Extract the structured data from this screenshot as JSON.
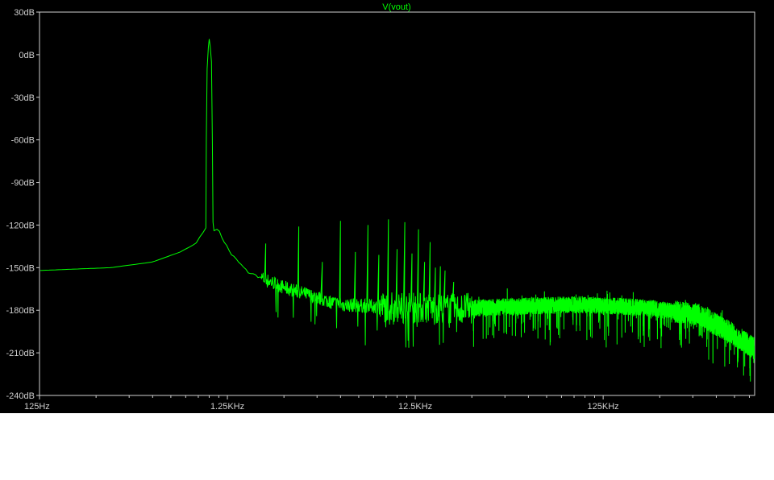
{
  "chart_data": {
    "type": "line",
    "title": "V(vout)",
    "title_color": "#00ff00",
    "background": "#000000",
    "axis_color": "#cfcfcf",
    "trace_color": "#00ff00",
    "x_scale": "log",
    "xlim": [
      125,
      800000
    ],
    "ylim": [
      -240,
      30
    ],
    "grid": false,
    "x_ticks": [
      {
        "value": 125,
        "label": "125Hz"
      },
      {
        "value": 1250,
        "label": "1.25KHz"
      },
      {
        "value": 12500,
        "label": "12.5KHz"
      },
      {
        "value": 125000,
        "label": "125KHz"
      }
    ],
    "y_ticks": [
      {
        "value": 30,
        "label": "30dB"
      },
      {
        "value": 0,
        "label": "0dB"
      },
      {
        "value": -30,
        "label": "-30dB"
      },
      {
        "value": -60,
        "label": "-60dB"
      },
      {
        "value": -90,
        "label": "-90dB"
      },
      {
        "value": -120,
        "label": "-120dB"
      },
      {
        "value": -150,
        "label": "-150dB"
      },
      {
        "value": -180,
        "label": "-180dB"
      },
      {
        "value": -210,
        "label": "-210dB"
      },
      {
        "value": -240,
        "label": "-240dB"
      }
    ],
    "series": [
      {
        "fundamental": {
          "x": 1000,
          "y": 11
        },
        "harmonics": [
          {
            "x": 2000,
            "y": -133
          },
          {
            "x": 3000,
            "y": -121
          },
          {
            "x": 4000,
            "y": -146
          },
          {
            "x": 5000,
            "y": -117
          },
          {
            "x": 6000,
            "y": -139
          },
          {
            "x": 7000,
            "y": -120
          },
          {
            "x": 8000,
            "y": -141
          },
          {
            "x": 9000,
            "y": -116
          },
          {
            "x": 10000,
            "y": -137
          },
          {
            "x": 11000,
            "y": -118
          },
          {
            "x": 12000,
            "y": -140
          },
          {
            "x": 13000,
            "y": -123
          },
          {
            "x": 14000,
            "y": -146
          },
          {
            "x": 15000,
            "y": -132
          },
          {
            "x": 16000,
            "y": -150
          },
          {
            "x": 17000,
            "y": -149
          },
          {
            "x": 18000,
            "y": -152
          },
          {
            "x": 20000,
            "y": -160
          }
        ],
        "floor": [
          {
            "x": 125,
            "y": -152
          },
          {
            "x": 300,
            "y": -150
          },
          {
            "x": 500,
            "y": -146
          },
          {
            "x": 700,
            "y": -139
          },
          {
            "x": 850,
            "y": -133
          },
          {
            "x": 950,
            "y": -122
          },
          {
            "x": 1100,
            "y": -122
          },
          {
            "x": 1300,
            "y": -140
          },
          {
            "x": 1600,
            "y": -153
          },
          {
            "x": 2500,
            "y": -164
          },
          {
            "x": 5000,
            "y": -176
          },
          {
            "x": 10000,
            "y": -178
          },
          {
            "x": 20000,
            "y": -179
          },
          {
            "x": 50000,
            "y": -177
          },
          {
            "x": 100000,
            "y": -176
          },
          {
            "x": 200000,
            "y": -178
          },
          {
            "x": 400000,
            "y": -183
          },
          {
            "x": 600000,
            "y": -196
          },
          {
            "x": 800000,
            "y": -207
          }
        ]
      }
    ]
  }
}
